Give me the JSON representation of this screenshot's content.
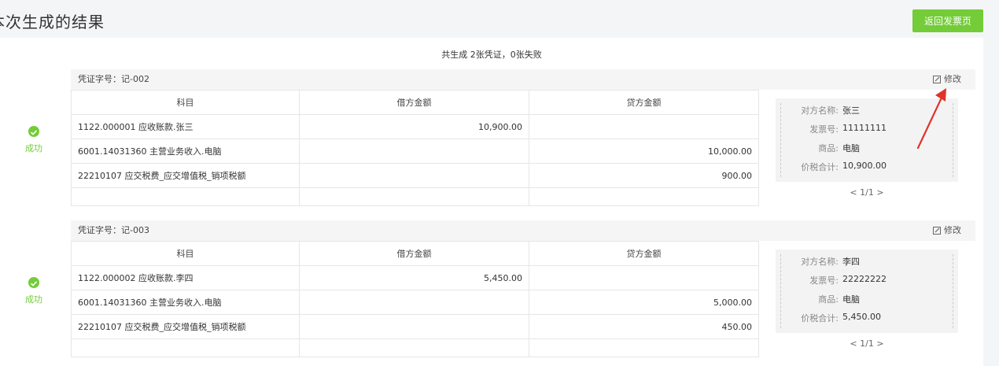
{
  "header": {
    "title": "本次生成的结果",
    "back_button": "返回发票页"
  },
  "summary": "共生成 2张凭证，0张失败",
  "columns": [
    "科目",
    "借方金额",
    "贷方金额"
  ],
  "vouchers": [
    {
      "voucher_no": "凭证字号：记-002",
      "edit_label": "修改",
      "status": "成功",
      "rows": [
        {
          "account": "1122.000001 应收账款.张三",
          "debit": "10,900.00",
          "credit": ""
        },
        {
          "account": "6001.14031360 主营业务收入.电脑",
          "debit": "",
          "credit": "10,000.00"
        },
        {
          "account": "22210107 应交税费_应交增值税_销项税额",
          "debit": "",
          "credit": "900.00"
        }
      ],
      "info": {
        "party_label": "对方名称:",
        "party": "张三",
        "invoice_label": "发票号:",
        "invoice": "11111111",
        "goods_label": "商品:",
        "goods": "电脑",
        "total_label": "价税合计:",
        "total": "10,900.00"
      },
      "pager": "< 1/1 >"
    },
    {
      "voucher_no": "凭证字号：记-003",
      "edit_label": "修改",
      "status": "成功",
      "rows": [
        {
          "account": "1122.000002 应收账款.李四",
          "debit": "5,450.00",
          "credit": ""
        },
        {
          "account": "6001.14031360 主营业务收入.电脑",
          "debit": "",
          "credit": "5,000.00"
        },
        {
          "account": "22210107 应交税费_应交增值税_销项税额",
          "debit": "",
          "credit": "450.00"
        }
      ],
      "info": {
        "party_label": "对方名称:",
        "party": "李四",
        "invoice_label": "发票号:",
        "invoice": "22222222",
        "goods_label": "商品:",
        "goods": "电脑",
        "total_label": "价税合计:",
        "total": "5,450.00"
      },
      "pager": "< 1/1 >"
    }
  ],
  "colors": {
    "accent": "#73cc38",
    "annotation_arrow": "#e0332a"
  },
  "icons": [
    "check-circle-icon",
    "edit-icon",
    "annotation-arrow"
  ]
}
